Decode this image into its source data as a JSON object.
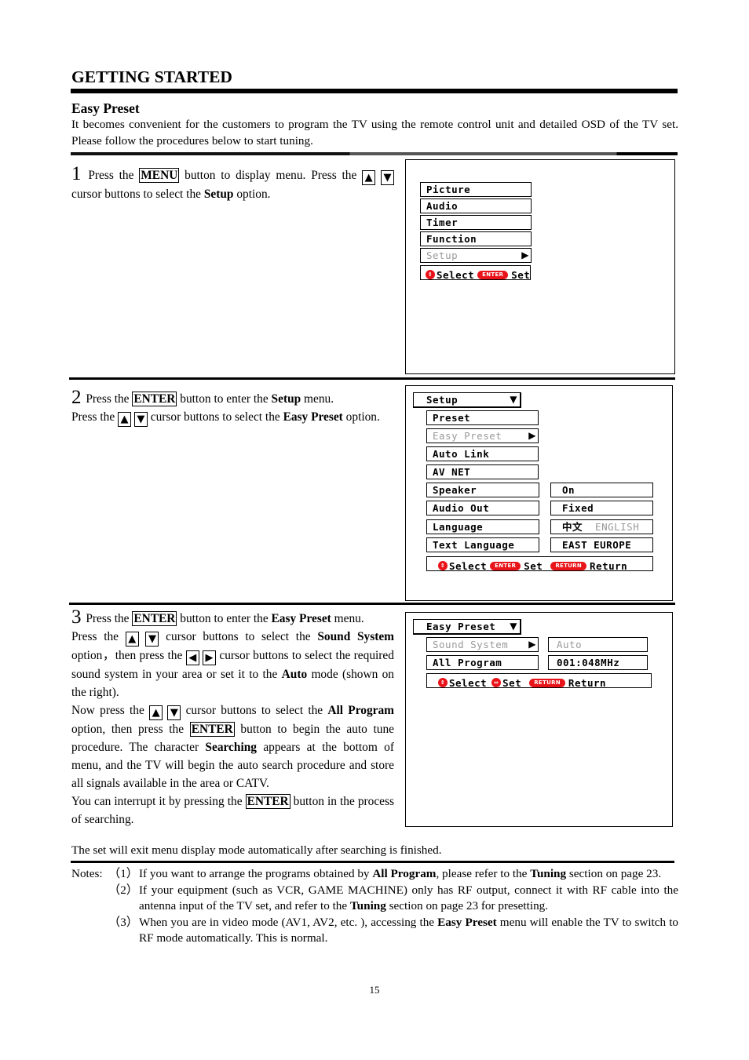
{
  "section_title": "GETTING STARTED",
  "subsection_title": "Easy Preset",
  "intro": "It becomes convenient for the customers to program the TV using the remote control unit and detailed OSD of the TV set. Please follow the procedures below to start tuning.",
  "steps": [
    {
      "number": "1",
      "segments": {
        "t1": "Press the",
        "k1": "MENU",
        "t2": "button to display menu. Press the",
        "a1": "▲",
        "a2": "▼",
        "t3": "cursor buttons to select the",
        "b1": "Setup",
        "t4": "option."
      }
    },
    {
      "number": "2",
      "segments": {
        "t1": "Press the",
        "k1": "ENTER",
        "t2": "button to enter the",
        "b1": "Setup",
        "t3": "menu.",
        "t4": "Press the",
        "a1": "▲",
        "a2": "▼",
        "t5": "cursor buttons to select the",
        "b2": "Easy Preset",
        "t6": "option."
      }
    },
    {
      "number": "3",
      "segments": {
        "t1": "Press the",
        "k1": "ENTER",
        "t2": "button to enter the",
        "b1": "Easy Preset",
        "t3": "menu.",
        "t4": "Press the",
        "a1": "▲",
        "a2": "▼",
        "t5": "cursor buttons to select the",
        "b2": "Sound System",
        "t6": "option，then press the",
        "a3": "◀",
        "a4": "▶",
        "t7": "cursor buttons to select the required sound system in your area or set it to the",
        "b3": "Auto",
        "t8": "mode (shown on the right).",
        "t9": "Now press the",
        "a5": "▲",
        "a6": "▼",
        "t10": "cursor buttons to select the",
        "b4": "All Program",
        "t11": "option, then press the",
        "k2": "ENTER",
        "t12": "button to begin the auto tune procedure. The character",
        "b5": "Searching",
        "t13": "appears at the bottom of menu, and the TV will begin the auto search procedure and store all signals available in the area or CATV.",
        "t14": "You can interrupt it by pressing the",
        "k3": "ENTER",
        "t15": "button in the process of searching."
      }
    }
  ],
  "closing": "The set will exit menu display mode automatically after searching is finished.",
  "osd": {
    "main_menu": {
      "items": [
        "Picture",
        "Audio",
        "Timer",
        "Function",
        "Setup"
      ],
      "selected_index": 4,
      "hint": {
        "select": "Select",
        "enter_pill": "ENTER",
        "set": "Set"
      }
    },
    "setup_menu": {
      "header": "Setup",
      "items": [
        {
          "label": "Preset",
          "value": ""
        },
        {
          "label": "Easy Preset",
          "value": ""
        },
        {
          "label": "Auto Link",
          "value": ""
        },
        {
          "label": "AV NET",
          "value": ""
        },
        {
          "label": "Speaker",
          "value": "On"
        },
        {
          "label": "Audio Out",
          "value": "Fixed"
        },
        {
          "label": "Language",
          "value_primary": "中文",
          "value_secondary": "ENGLISH"
        },
        {
          "label": "Text Language",
          "value": "EAST EUROPE"
        }
      ],
      "selected_index": 1,
      "hint": {
        "select": "Select",
        "enter_pill": "ENTER",
        "set": "Set",
        "return_pill": "RETURN",
        "return": "Return"
      }
    },
    "easy_preset_menu": {
      "header": "Easy Preset",
      "items": [
        {
          "label": "Sound System",
          "value": "Auto"
        },
        {
          "label": "All Program",
          "value": "001:048MHz"
        }
      ],
      "selected_index": 0,
      "hint": {
        "select": "Select",
        "set": "Set",
        "return_pill": "RETURN",
        "return": "Return"
      }
    }
  },
  "notes": {
    "prefix": "Notes:",
    "items": [
      {
        "idx": "（1）",
        "t1": "If you want to arrange the programs obtained by",
        "b1": "All Program",
        "t2": ", please refer to the",
        "b2": "Tuning",
        "t3": "section on page 23."
      },
      {
        "idx": "（2）",
        "t1": "If your equipment (such as VCR, GAME MACHINE) only has RF output, connect it with RF cable into the antenna input of the TV set, and refer to the",
        "b1": "Tuning",
        "t2": "section on page 23 for presetting."
      },
      {
        "idx": "（3）",
        "t1": "When you are in video mode (AV1, AV2, etc. ), accessing the",
        "b1": "Easy Preset",
        "t2": "menu will enable the TV to switch to RF mode automatically. This is normal."
      }
    ]
  },
  "page_number": "15",
  "colors": {
    "accent_red": "#e8141a",
    "dim_text": "#9a9a9a"
  }
}
